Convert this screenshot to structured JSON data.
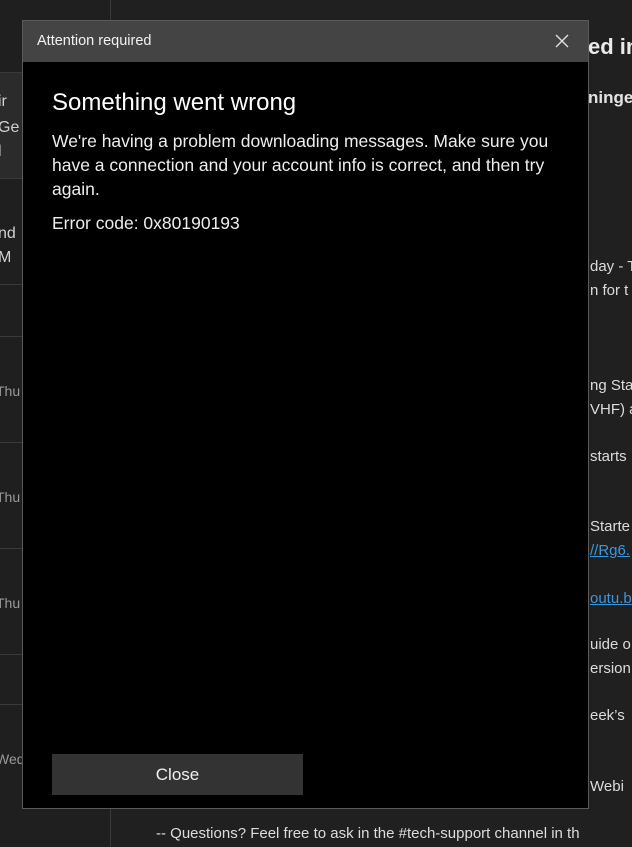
{
  "background": {
    "list_items": [
      {
        "line1": "ir",
        "line2": "Ge",
        "line3": "l"
      },
      {
        "line1": "nd",
        "line2": "M"
      },
      {
        "date": "Thu"
      },
      {
        "date": "Thu"
      },
      {
        "date": "Thu"
      },
      {
        "date": "Wed"
      }
    ],
    "reading": {
      "title_fragment": "ed in",
      "subtitle_fragment": "ninge",
      "lines": [
        {
          "text": "day - T"
        },
        {
          "text": "n for t"
        },
        {
          "text": "ng Sta"
        },
        {
          "text": "VHF) a"
        },
        {
          "text": "starts"
        },
        {
          "text": "Starte"
        },
        {
          "text": "//Rg6.",
          "link": true
        },
        {
          "text": "outu.b",
          "link": true
        },
        {
          "text": "uide o"
        },
        {
          "text": "ersion"
        },
        {
          "text": "eek’s"
        },
        {
          "text": "Webi"
        }
      ],
      "footer": "-- Questions? Feel free to ask in the #tech-support channel in th"
    }
  },
  "dialog": {
    "title": "Attention required",
    "heading": "Something went wrong",
    "message": "We're having a problem downloading messages. Make sure you have a connection and your account info is correct, and then try again.",
    "error_code": "Error code: 0x80190193",
    "close_button": "Close",
    "close_icon": "close-icon"
  }
}
